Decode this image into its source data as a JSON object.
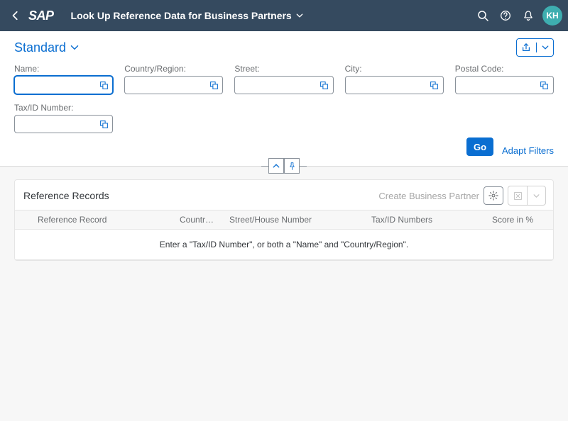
{
  "shell": {
    "logo_text": "SAP",
    "app_title": "Look Up Reference Data for Business Partners",
    "user_initials": "KH"
  },
  "variant": {
    "name": "Standard"
  },
  "filters": {
    "name_label": "Name:",
    "country_label": "Country/Region:",
    "street_label": "Street:",
    "city_label": "City:",
    "postal_label": "Postal Code:",
    "taxid_label": "Tax/ID Number:",
    "go_label": "Go",
    "adapt_label": "Adapt Filters",
    "values": {
      "name": "",
      "country": "",
      "street": "",
      "city": "",
      "postal": "",
      "taxid": ""
    }
  },
  "table": {
    "title": "Reference Records",
    "create_label": "Create Business Partner",
    "columns": {
      "record": "Reference Record",
      "country": "Country/Re...",
      "street": "Street/House Number",
      "taxids": "Tax/ID Numbers",
      "score": "Score in %"
    },
    "empty_text": "Enter a \"Tax/ID Number\", or both a \"Name\" and \"Country/Region\"."
  }
}
